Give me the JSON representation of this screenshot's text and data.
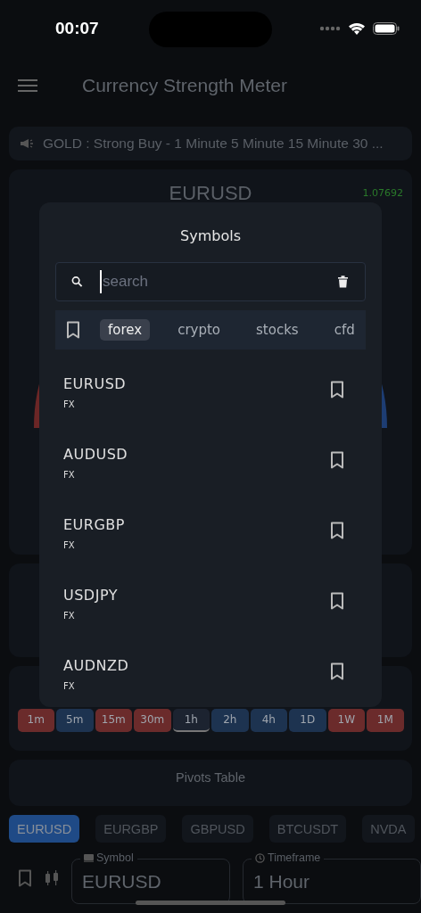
{
  "status_bar": {
    "time": "00:07"
  },
  "header": {
    "title": "Currency Strength Meter"
  },
  "ticker": {
    "text": "GOLD : Strong Buy - 1 Minute 5 Minute 15 Minute 30 ..."
  },
  "summary_card": {
    "symbol": "EURUSD",
    "price": "1.07692"
  },
  "timeframe_chips": [
    {
      "label": "1m",
      "color": "#6b2b2b",
      "selected": false
    },
    {
      "label": "5m",
      "color": "#1d3350",
      "selected": false
    },
    {
      "label": "15m",
      "color": "#6b2b2b",
      "selected": false
    },
    {
      "label": "30m",
      "color": "#6b2b2b",
      "selected": false
    },
    {
      "label": "1h",
      "color": "#1c2330",
      "selected": true
    },
    {
      "label": "2h",
      "color": "#1d3350",
      "selected": false
    },
    {
      "label": "4h",
      "color": "#1d3350",
      "selected": false
    },
    {
      "label": "1D",
      "color": "#1d3350",
      "selected": false
    },
    {
      "label": "1W",
      "color": "#6b2b2b",
      "selected": false
    },
    {
      "label": "1M",
      "color": "#6b2b2b",
      "selected": false
    }
  ],
  "pivots_card": {
    "title": "Pivots Table"
  },
  "symbol_chips": [
    {
      "label": "EURUSD",
      "selected": true
    },
    {
      "label": "EURGBP",
      "selected": false
    },
    {
      "label": "GBPUSD",
      "selected": false
    },
    {
      "label": "BTCUSDT",
      "selected": false
    },
    {
      "label": "NVDA",
      "selected": false
    }
  ],
  "bottom_bar": {
    "symbol_field": {
      "label": "Symbol",
      "value": "EURUSD"
    },
    "timeframe_field": {
      "label": "Timeframe",
      "value": "1 Hour"
    }
  },
  "modal": {
    "title": "Symbols",
    "search": {
      "placeholder": "search"
    },
    "tabs": [
      {
        "label": "forex",
        "selected": true
      },
      {
        "label": "crypto",
        "selected": false
      },
      {
        "label": "stocks",
        "selected": false
      },
      {
        "label": "cfd",
        "selected": false
      }
    ],
    "items": [
      {
        "symbol": "EURUSD",
        "type": "FX"
      },
      {
        "symbol": "AUDUSD",
        "type": "FX"
      },
      {
        "symbol": "EURGBP",
        "type": "FX"
      },
      {
        "symbol": "USDJPY",
        "type": "FX"
      },
      {
        "symbol": "AUDNZD",
        "type": "FX"
      }
    ]
  }
}
